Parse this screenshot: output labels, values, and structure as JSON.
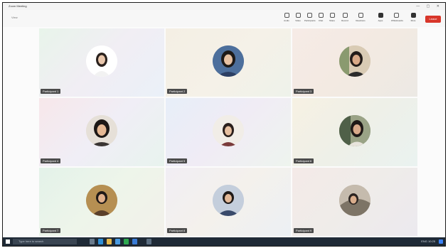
{
  "window": {
    "title": "Zoom Meeting",
    "controls": "—  ▢  ✕"
  },
  "toolbar": {
    "view_label": "View",
    "items": [
      {
        "label": "Audio"
      },
      {
        "label": "Video"
      },
      {
        "label": "Participants"
      },
      {
        "label": "Chat"
      },
      {
        "label": "Share"
      },
      {
        "label": "Record"
      },
      {
        "label": "Reactions"
      },
      {
        "label": "Apps"
      },
      {
        "label": "Whiteboards"
      },
      {
        "label": "More"
      }
    ],
    "leave_label": "Leave"
  },
  "participants": [
    {
      "name": "Participant 1"
    },
    {
      "name": "Participant 2"
    },
    {
      "name": "Participant 3"
    },
    {
      "name": "Participant 4"
    },
    {
      "name": "Participant 5"
    },
    {
      "name": "Participant 6"
    },
    {
      "name": "Participant 7"
    },
    {
      "name": "Participant 8"
    },
    {
      "name": "Participant 9"
    }
  ],
  "taskbar": {
    "search_placeholder": "Type here to search",
    "tray_text": "ENG  10:25"
  },
  "colors": {
    "leave": "#d8362a",
    "taskbar": "#1f2a36",
    "name_tag": "#4b4b4b"
  }
}
